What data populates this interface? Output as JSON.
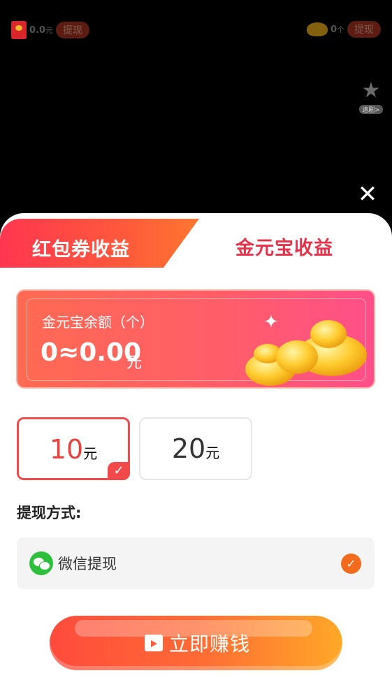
{
  "topbar": {
    "balance_amount": "0.0",
    "balance_unit": "元",
    "withdraw_left": "提现",
    "ingot_count": "0",
    "ingot_unit": "个",
    "withdraw_right": "提现"
  },
  "follow": {
    "label": "追剧>"
  },
  "close": {
    "glyph": "✕"
  },
  "tabs": {
    "red_packet": "红包券收益",
    "gold_ingot": "金元宝收益"
  },
  "balance": {
    "title": "金元宝余额（个）",
    "value": "0≈0.00",
    "unit": "元"
  },
  "amounts": [
    {
      "value": "10",
      "unit": "元",
      "selected": true
    },
    {
      "value": "20",
      "unit": "元",
      "selected": false
    }
  ],
  "method": {
    "title": "提现方式:",
    "wechat_label": "微信提现"
  },
  "earn_button": {
    "label": "立即赚钱"
  },
  "colors": {
    "accent_red": "#f24a4a",
    "accent_orange": "#f26b1c",
    "wechat_green": "#2ebf3c"
  }
}
